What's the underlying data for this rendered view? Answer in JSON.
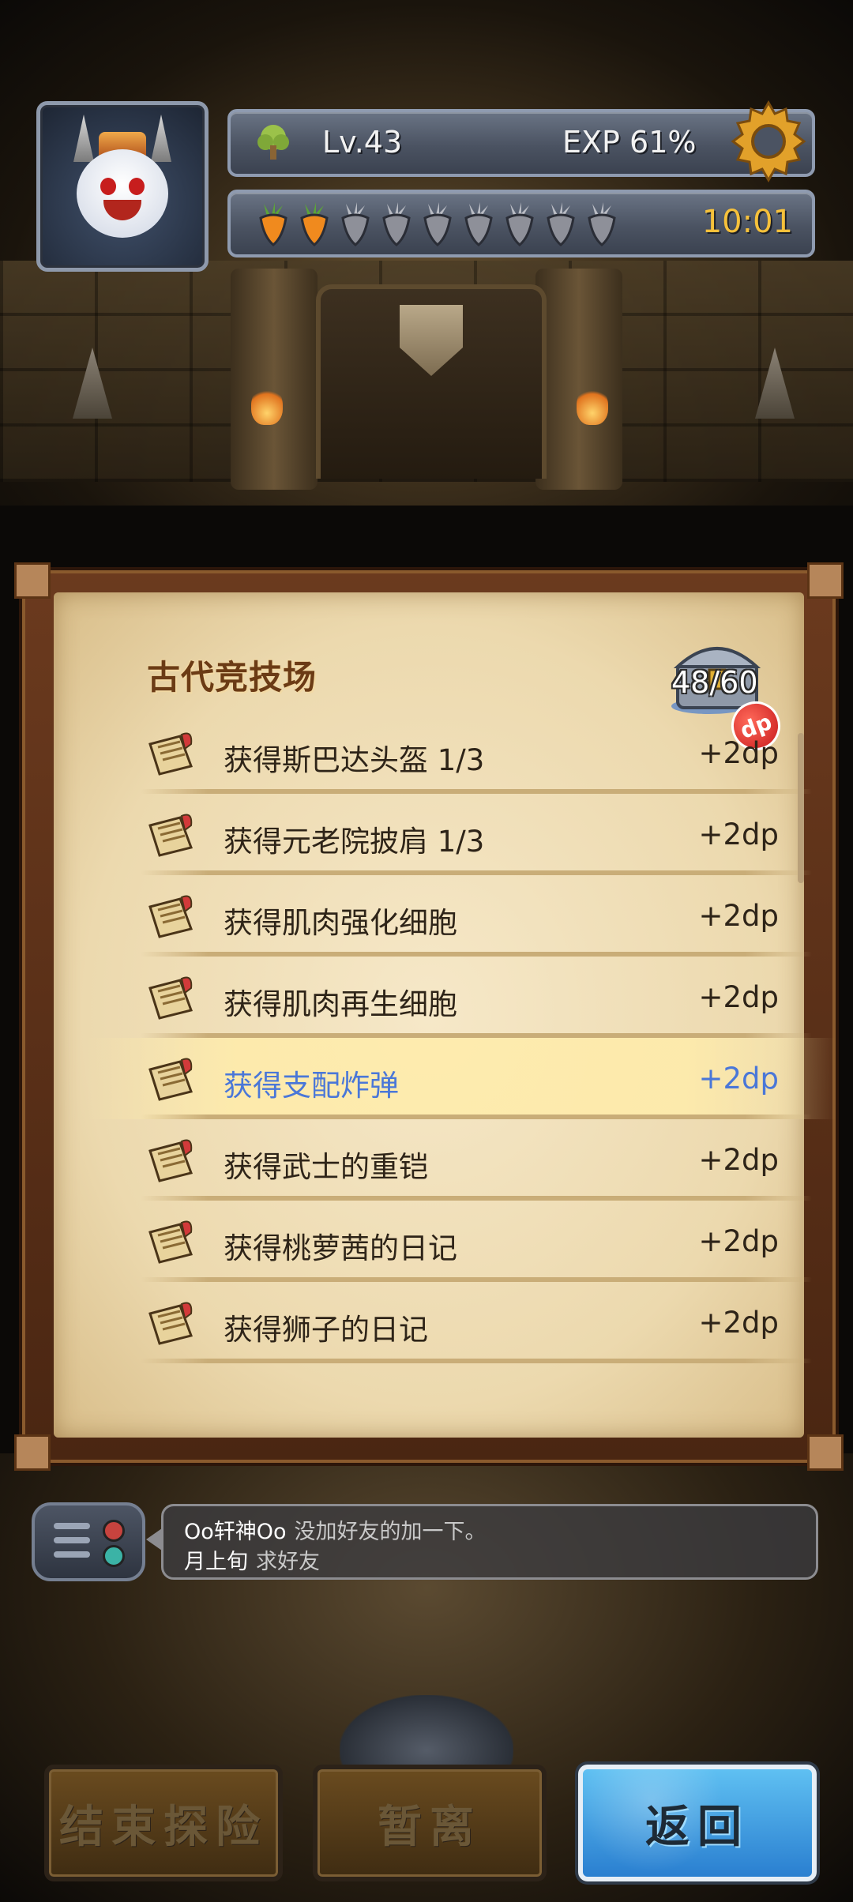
{
  "header": {
    "level": "Lv.43",
    "exp": "EXP 61%",
    "carrots_filled": 2,
    "carrots_total": 9,
    "timer": "10:01"
  },
  "panel": {
    "title": "古代竞技场",
    "chest_count": "48/60",
    "dp_badge": "dp",
    "items": [
      {
        "label": "获得斯巴达头盔 1/3",
        "reward": "+2dp",
        "highlighted": false
      },
      {
        "label": "获得元老院披肩 1/3",
        "reward": "+2dp",
        "highlighted": false
      },
      {
        "label": "获得肌肉强化细胞",
        "reward": "+2dp",
        "highlighted": false
      },
      {
        "label": "获得肌肉再生细胞",
        "reward": "+2dp",
        "highlighted": false
      },
      {
        "label": "获得支配炸弹",
        "reward": "+2dp",
        "highlighted": true
      },
      {
        "label": "获得武士的重铠",
        "reward": "+2dp",
        "highlighted": false
      },
      {
        "label": "获得桃萝茜的日记",
        "reward": "+2dp",
        "highlighted": false
      },
      {
        "label": "获得狮子的日记",
        "reward": "+2dp",
        "highlighted": false
      }
    ]
  },
  "chat": {
    "lines": [
      {
        "name": "Oo轩神Oo",
        "message": "没加好友的加一下。"
      },
      {
        "name": "月上旬",
        "message": "求好友"
      }
    ]
  },
  "buttons": {
    "end_explore": "结束探险",
    "leave": "暂离",
    "back": "返回"
  },
  "colors": {
    "highlight_text": "#4a77d8",
    "timer": "#f6c13b",
    "parchment": "#ecd9ae",
    "back_button": "#3a9be2"
  }
}
